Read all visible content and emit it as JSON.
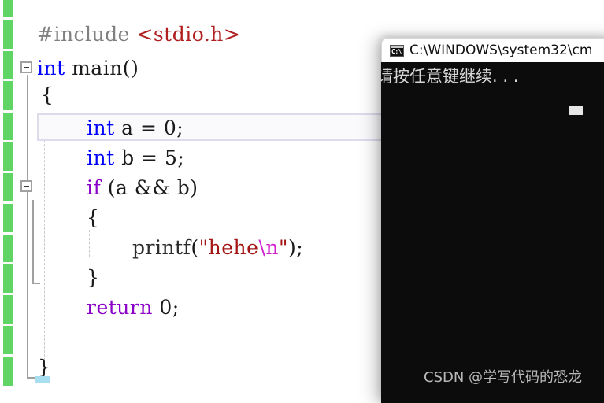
{
  "editor": {
    "gutter": {
      "change_bar_color": "#61d466",
      "fold_markers": [
        {
          "name": "fold-main",
          "glyph": "minus"
        },
        {
          "name": "fold-if",
          "glyph": "minus"
        }
      ]
    },
    "current_line_number": 4,
    "code_lines": [
      {
        "index": 1,
        "indent": 0,
        "tokens": [
          {
            "text": "#include ",
            "type": "preprocessor"
          },
          {
            "text": "<stdio.h>",
            "type": "header"
          }
        ]
      },
      {
        "index": 2,
        "indent": 0,
        "tokens": [
          {
            "text": "int",
            "type": "keyword"
          },
          {
            "text": " main()",
            "type": "plain"
          }
        ]
      },
      {
        "index": 3,
        "indent": 0,
        "tokens": [
          {
            "text": "{",
            "type": "plain"
          }
        ]
      },
      {
        "index": 4,
        "indent": 1,
        "tokens": [
          {
            "text": "int",
            "type": "keyword"
          },
          {
            "text": " a = 0;",
            "type": "plain"
          }
        ]
      },
      {
        "index": 5,
        "indent": 1,
        "tokens": [
          {
            "text": "int",
            "type": "keyword"
          },
          {
            "text": " b = 5;",
            "type": "plain"
          }
        ]
      },
      {
        "index": 6,
        "indent": 1,
        "tokens": [
          {
            "text": "if",
            "type": "control"
          },
          {
            "text": " (a && b)",
            "type": "plain"
          }
        ]
      },
      {
        "index": 7,
        "indent": 1,
        "tokens": [
          {
            "text": "{",
            "type": "plain"
          }
        ]
      },
      {
        "index": 8,
        "indent": 2,
        "tokens": [
          {
            "text": "printf",
            "type": "function"
          },
          {
            "text": "(",
            "type": "plain"
          },
          {
            "text": "\"hehe",
            "type": "string"
          },
          {
            "text": "\\n",
            "type": "escape"
          },
          {
            "text": "\"",
            "type": "string"
          },
          {
            "text": ");",
            "type": "plain"
          }
        ]
      },
      {
        "index": 9,
        "indent": 1,
        "tokens": [
          {
            "text": "}",
            "type": "plain"
          }
        ]
      },
      {
        "index": 10,
        "indent": 1,
        "tokens": [
          {
            "text": "return",
            "type": "control"
          },
          {
            "text": " 0;",
            "type": "plain"
          }
        ]
      },
      {
        "index": 11,
        "indent": 1,
        "tokens": []
      },
      {
        "index": 12,
        "indent": 0,
        "tokens": [
          {
            "text": "}",
            "type": "plain"
          }
        ]
      }
    ],
    "colors": {
      "preprocessor": "#808080",
      "header": "#b02020",
      "keyword": "#0000ff",
      "control": "#8b00c8",
      "string": "#a31515",
      "escape": "#d020d0",
      "plain": "#1a1a1a",
      "current_line_bg": "#fafafd",
      "current_line_border": "#dcdcec"
    }
  },
  "console": {
    "title": "C:\\WINDOWS\\system32\\cm",
    "icon_glyph": "C:\\",
    "output_text": "请按任意键继续. . .",
    "caret": "block",
    "watermark": "CSDN @学写代码的恐龙",
    "background": "#0c0c0c",
    "text_color": "#d6d6d6"
  }
}
